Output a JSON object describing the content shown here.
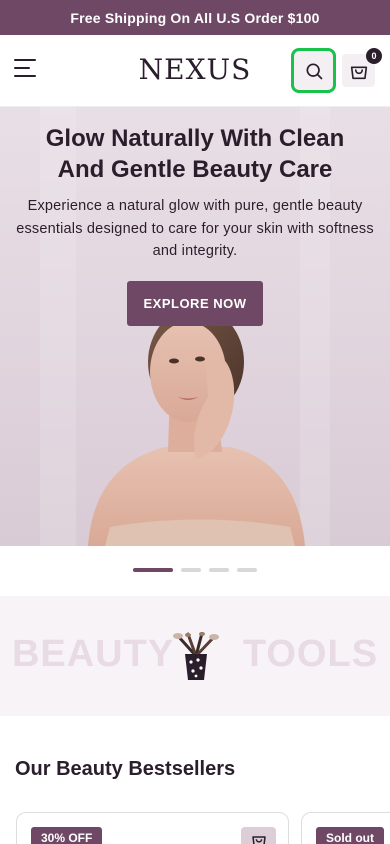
{
  "announcement": {
    "text": "Free Shipping On All U.S Order $100"
  },
  "header": {
    "logo": "NEXUS",
    "cart_count": "0",
    "icons": {
      "menu": "hamburger-menu-icon",
      "search": "search-icon",
      "cart": "shopping-bag-icon"
    }
  },
  "hero": {
    "title": "Glow Naturally With Clean And Gentle Beauty Care",
    "subtitle": "Experience a natural glow with pure, gentle beauty essentials designed to care for your skin with softness and integrity.",
    "cta_label": "EXPLORE NOW",
    "slides_count": 4,
    "active_slide": 1
  },
  "tools_banner": {
    "text_left": "BEAUTY",
    "text_right": "TOOLS"
  },
  "bestsellers": {
    "title": "Our Beauty Bestsellers",
    "cards": [
      {
        "badge": "30% OFF"
      },
      {
        "badge": "Sold out"
      }
    ]
  },
  "colors": {
    "brand": "#6e4864",
    "focus_ring": "#19c24a",
    "text": "#2b1e2c"
  }
}
